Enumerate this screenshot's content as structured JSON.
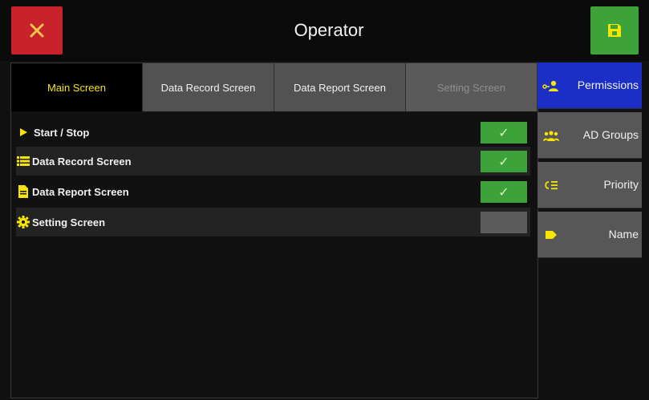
{
  "header": {
    "title": "Operator",
    "close_icon": "close-icon",
    "save_icon": "save-icon",
    "close_color": "#c8222b",
    "save_color": "#3ea23a"
  },
  "tabs": [
    {
      "label": "Main Screen",
      "state": "active"
    },
    {
      "label": "Data Record Screen",
      "state": "normal"
    },
    {
      "label": "Data Report Screen",
      "state": "normal"
    },
    {
      "label": "Setting Screen",
      "state": "disabled"
    }
  ],
  "permissions": [
    {
      "label": "Start / Stop",
      "icon": "play-icon",
      "checked": true
    },
    {
      "label": "Data Record Screen",
      "icon": "list-icon",
      "checked": true
    },
    {
      "label": "Data Report Screen",
      "icon": "document-icon",
      "checked": true
    },
    {
      "label": "Setting Screen",
      "icon": "gear-icon",
      "checked": false
    }
  ],
  "sidebar": [
    {
      "label": "Permissions",
      "icon": "user-key-icon",
      "active": true
    },
    {
      "label": "AD Groups",
      "icon": "users-group-icon",
      "active": false
    },
    {
      "label": "Priority",
      "icon": "priority-list-icon",
      "active": false
    },
    {
      "label": "Name",
      "icon": "tag-icon",
      "active": false
    }
  ],
  "colors": {
    "accent_yellow": "#f7e400",
    "active_blue": "#1b2fc6",
    "check_green": "#3ea23a"
  }
}
